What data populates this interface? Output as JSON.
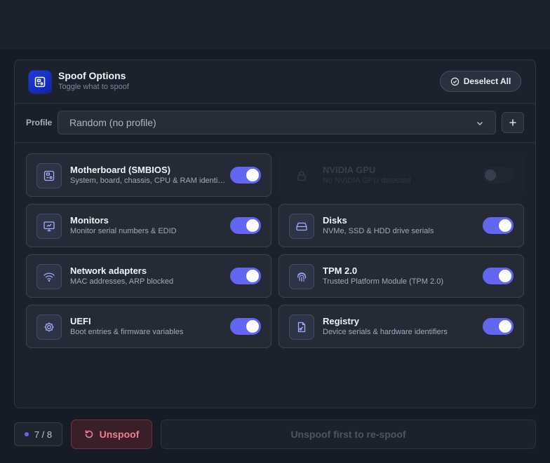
{
  "panel": {
    "title": "Spoof Options",
    "subtitle": "Toggle what to spoof",
    "deselect_label": "Deselect All"
  },
  "profile": {
    "label": "Profile",
    "selected": "Random (no profile)"
  },
  "options": [
    {
      "title": "Motherboard (SMBIOS)",
      "desc": "System, board, chassis, CPU & RAM identifiers",
      "enabled": true,
      "icon": "motherboard-icon"
    },
    {
      "title": "NVIDIA GPU",
      "desc": "No NVIDIA GPU detected",
      "enabled": false,
      "disabled": true,
      "icon": "lock-icon"
    },
    {
      "title": "Monitors",
      "desc": "Monitor serial numbers & EDID",
      "enabled": true,
      "icon": "monitor-icon"
    },
    {
      "title": "Disks",
      "desc": "NVMe, SSD & HDD drive serials",
      "enabled": true,
      "icon": "disk-icon"
    },
    {
      "title": "Network adapters",
      "desc": "MAC addresses, ARP blocked",
      "enabled": true,
      "icon": "wifi-icon"
    },
    {
      "title": "TPM 2.0",
      "desc": "Trusted Platform Module (TPM 2.0)",
      "enabled": true,
      "icon": "fingerprint-icon"
    },
    {
      "title": "UEFI",
      "desc": "Boot entries & firmware variables",
      "enabled": true,
      "icon": "gear-icon"
    },
    {
      "title": "Registry",
      "desc": "Device serials & hardware identifiers",
      "enabled": true,
      "icon": "registry-file-icon"
    }
  ],
  "footer": {
    "count": "7 / 8",
    "unspoof_label": "Unspoof",
    "respoof_label": "Unspoof first to re-spoof"
  },
  "colors": {
    "accent": "#6366f1",
    "danger": "#f07e90",
    "background": "#161c26"
  }
}
